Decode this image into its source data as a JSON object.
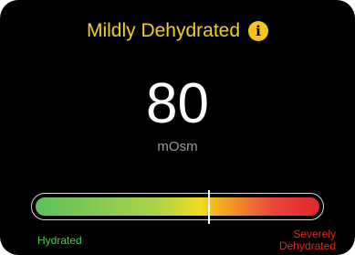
{
  "status": {
    "title": "Mildly Dehydrated",
    "title_color": "#f5d020",
    "info_icon": "info-icon",
    "info_icon_color": "#f5c518"
  },
  "reading": {
    "value": "80",
    "unit": "mOsm"
  },
  "gauge": {
    "level": 0.61,
    "gradient_colors": [
      "#5bc25b",
      "#aad24a",
      "#f2dc21",
      "#f5a623",
      "#e8453c",
      "#e32727"
    ],
    "low_label": "Hydrated",
    "low_color": "#4cc94c",
    "high_label": "Severely Dehydrated",
    "high_color": "#e2281d"
  }
}
